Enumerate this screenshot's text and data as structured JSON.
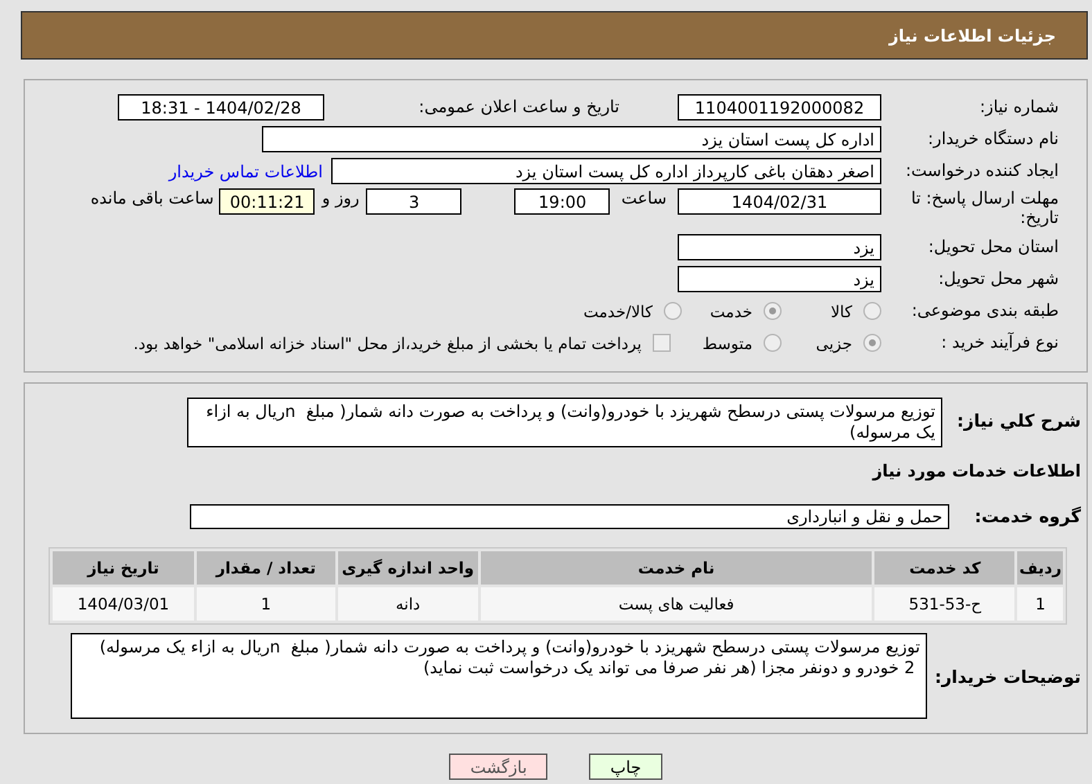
{
  "header": {
    "title": "جزئیات اطلاعات نیاز"
  },
  "need_number": {
    "label": "شماره نیاز:",
    "value": "1104001192000082"
  },
  "announce": {
    "label": "تاریخ و ساعت اعلان عمومی:",
    "value": "1404/02/28 - 18:31"
  },
  "buyer_org": {
    "label": "نام دستگاه خریدار:",
    "value": "اداره کل پست استان یزد"
  },
  "creator": {
    "label": "ایجاد کننده درخواست:",
    "value": "اصغر دهقان باغی کارپرداز اداره کل پست استان یزد",
    "link": "اطلاعات تماس خریدار"
  },
  "deadline": {
    "label": "مهلت ارسال پاسخ: تا تاریخ:",
    "date": "1404/02/31",
    "time_label": "ساعت",
    "time": "19:00",
    "days": "3",
    "days_label": "روز و",
    "remaining": "00:11:21",
    "remaining_label": "ساعت باقی مانده"
  },
  "province": {
    "label": "استان محل تحویل:",
    "value": "یزد"
  },
  "city": {
    "label": "شهر محل تحویل:",
    "value": "یزد"
  },
  "category": {
    "label": "طبقه بندی موضوعی:",
    "options": [
      {
        "label": "کالا",
        "selected": false
      },
      {
        "label": "خدمت",
        "selected": true
      },
      {
        "label": "کالا/خدمت",
        "selected": false
      }
    ]
  },
  "process": {
    "label": "نوع فرآیند خرید :",
    "options": [
      {
        "label": "جزیی",
        "selected": true
      },
      {
        "label": "متوسط",
        "selected": false
      }
    ],
    "payment": {
      "checked": false,
      "label": "پرداخت تمام یا بخشی از مبلغ خرید،از محل \"اسناد خزانه اسلامی\" خواهد بود."
    }
  },
  "description": {
    "label": "شرح کلي نياز:",
    "value": "توزیع مرسولات پستی درسطح شهریزد با خودرو(وانت) و پرداخت به صورت دانه شمار( مبلغ  nریال به ازاء یک مرسوله)"
  },
  "services_heading": "اطلاعات خدمات مورد نياز",
  "service_group": {
    "label": "گروه خدمت:",
    "value": "حمل و نقل و انبارداری"
  },
  "table": {
    "columns": [
      "ردیف",
      "کد خدمت",
      "نام خدمت",
      "واحد اندازه گیری",
      "تعداد / مقدار",
      "تاریخ نیاز"
    ],
    "rows": [
      [
        "1",
        "ح-53-531",
        "فعالیت های پست",
        "دانه",
        "1",
        "1404/03/01"
      ]
    ]
  },
  "buyer_notes": {
    "label": "توضیحات خریدار:",
    "value": "توزیع مرسولات پستی درسطح شهریزد با خودرو(وانت) و پرداخت به صورت دانه شمار( مبلغ  nریال به ازاء یک مرسوله)\n 2 خودرو و دونفر مجزا (هر نفر صرفا می تواند یک درخواست ثبت نماید)"
  },
  "buttons": [
    {
      "label": "چاپ",
      "kind": "print"
    },
    {
      "label": "بازگشت",
      "kind": "back"
    }
  ]
}
